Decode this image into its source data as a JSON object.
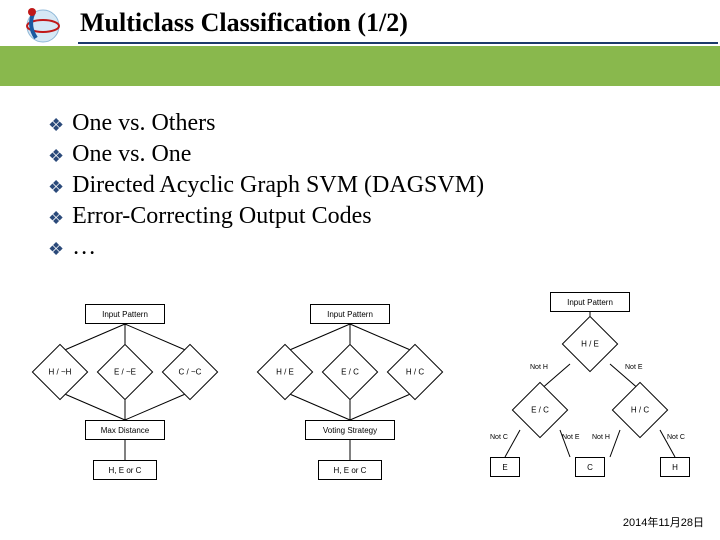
{
  "header": {
    "title": "Multiclass Classification (1/2)",
    "logo_name": "istic-logo"
  },
  "bullets": [
    "One vs. Others",
    "One vs. One",
    "Directed Acyclic Graph SVM (DAGSVM)",
    "Error-Correcting Output Codes",
    "…"
  ],
  "diagram1": {
    "input": "Input Pattern",
    "n1": "H / ~H",
    "n2": "E / ~E",
    "n3": "C / ~C",
    "agg": "Max Distance",
    "out": "H, E or C"
  },
  "diagram2": {
    "input": "Input Pattern",
    "n1": "H / E",
    "n2": "E / C",
    "n3": "H / C",
    "agg": "Voting Strategy",
    "out": "H, E or C"
  },
  "diagram3": {
    "input": "Input Pattern",
    "root": "H / E",
    "left": "E / C",
    "right": "H / C",
    "e_notH": "Not H",
    "e_notE": "Not E",
    "e_notC": "Not C",
    "e_notE2": "Not E",
    "e_notH2": "Not H",
    "e_notC2": "Not C",
    "out_e": "E",
    "out_c": "C",
    "out_h": "H"
  },
  "footer": {
    "date": "2014年11月28日"
  }
}
